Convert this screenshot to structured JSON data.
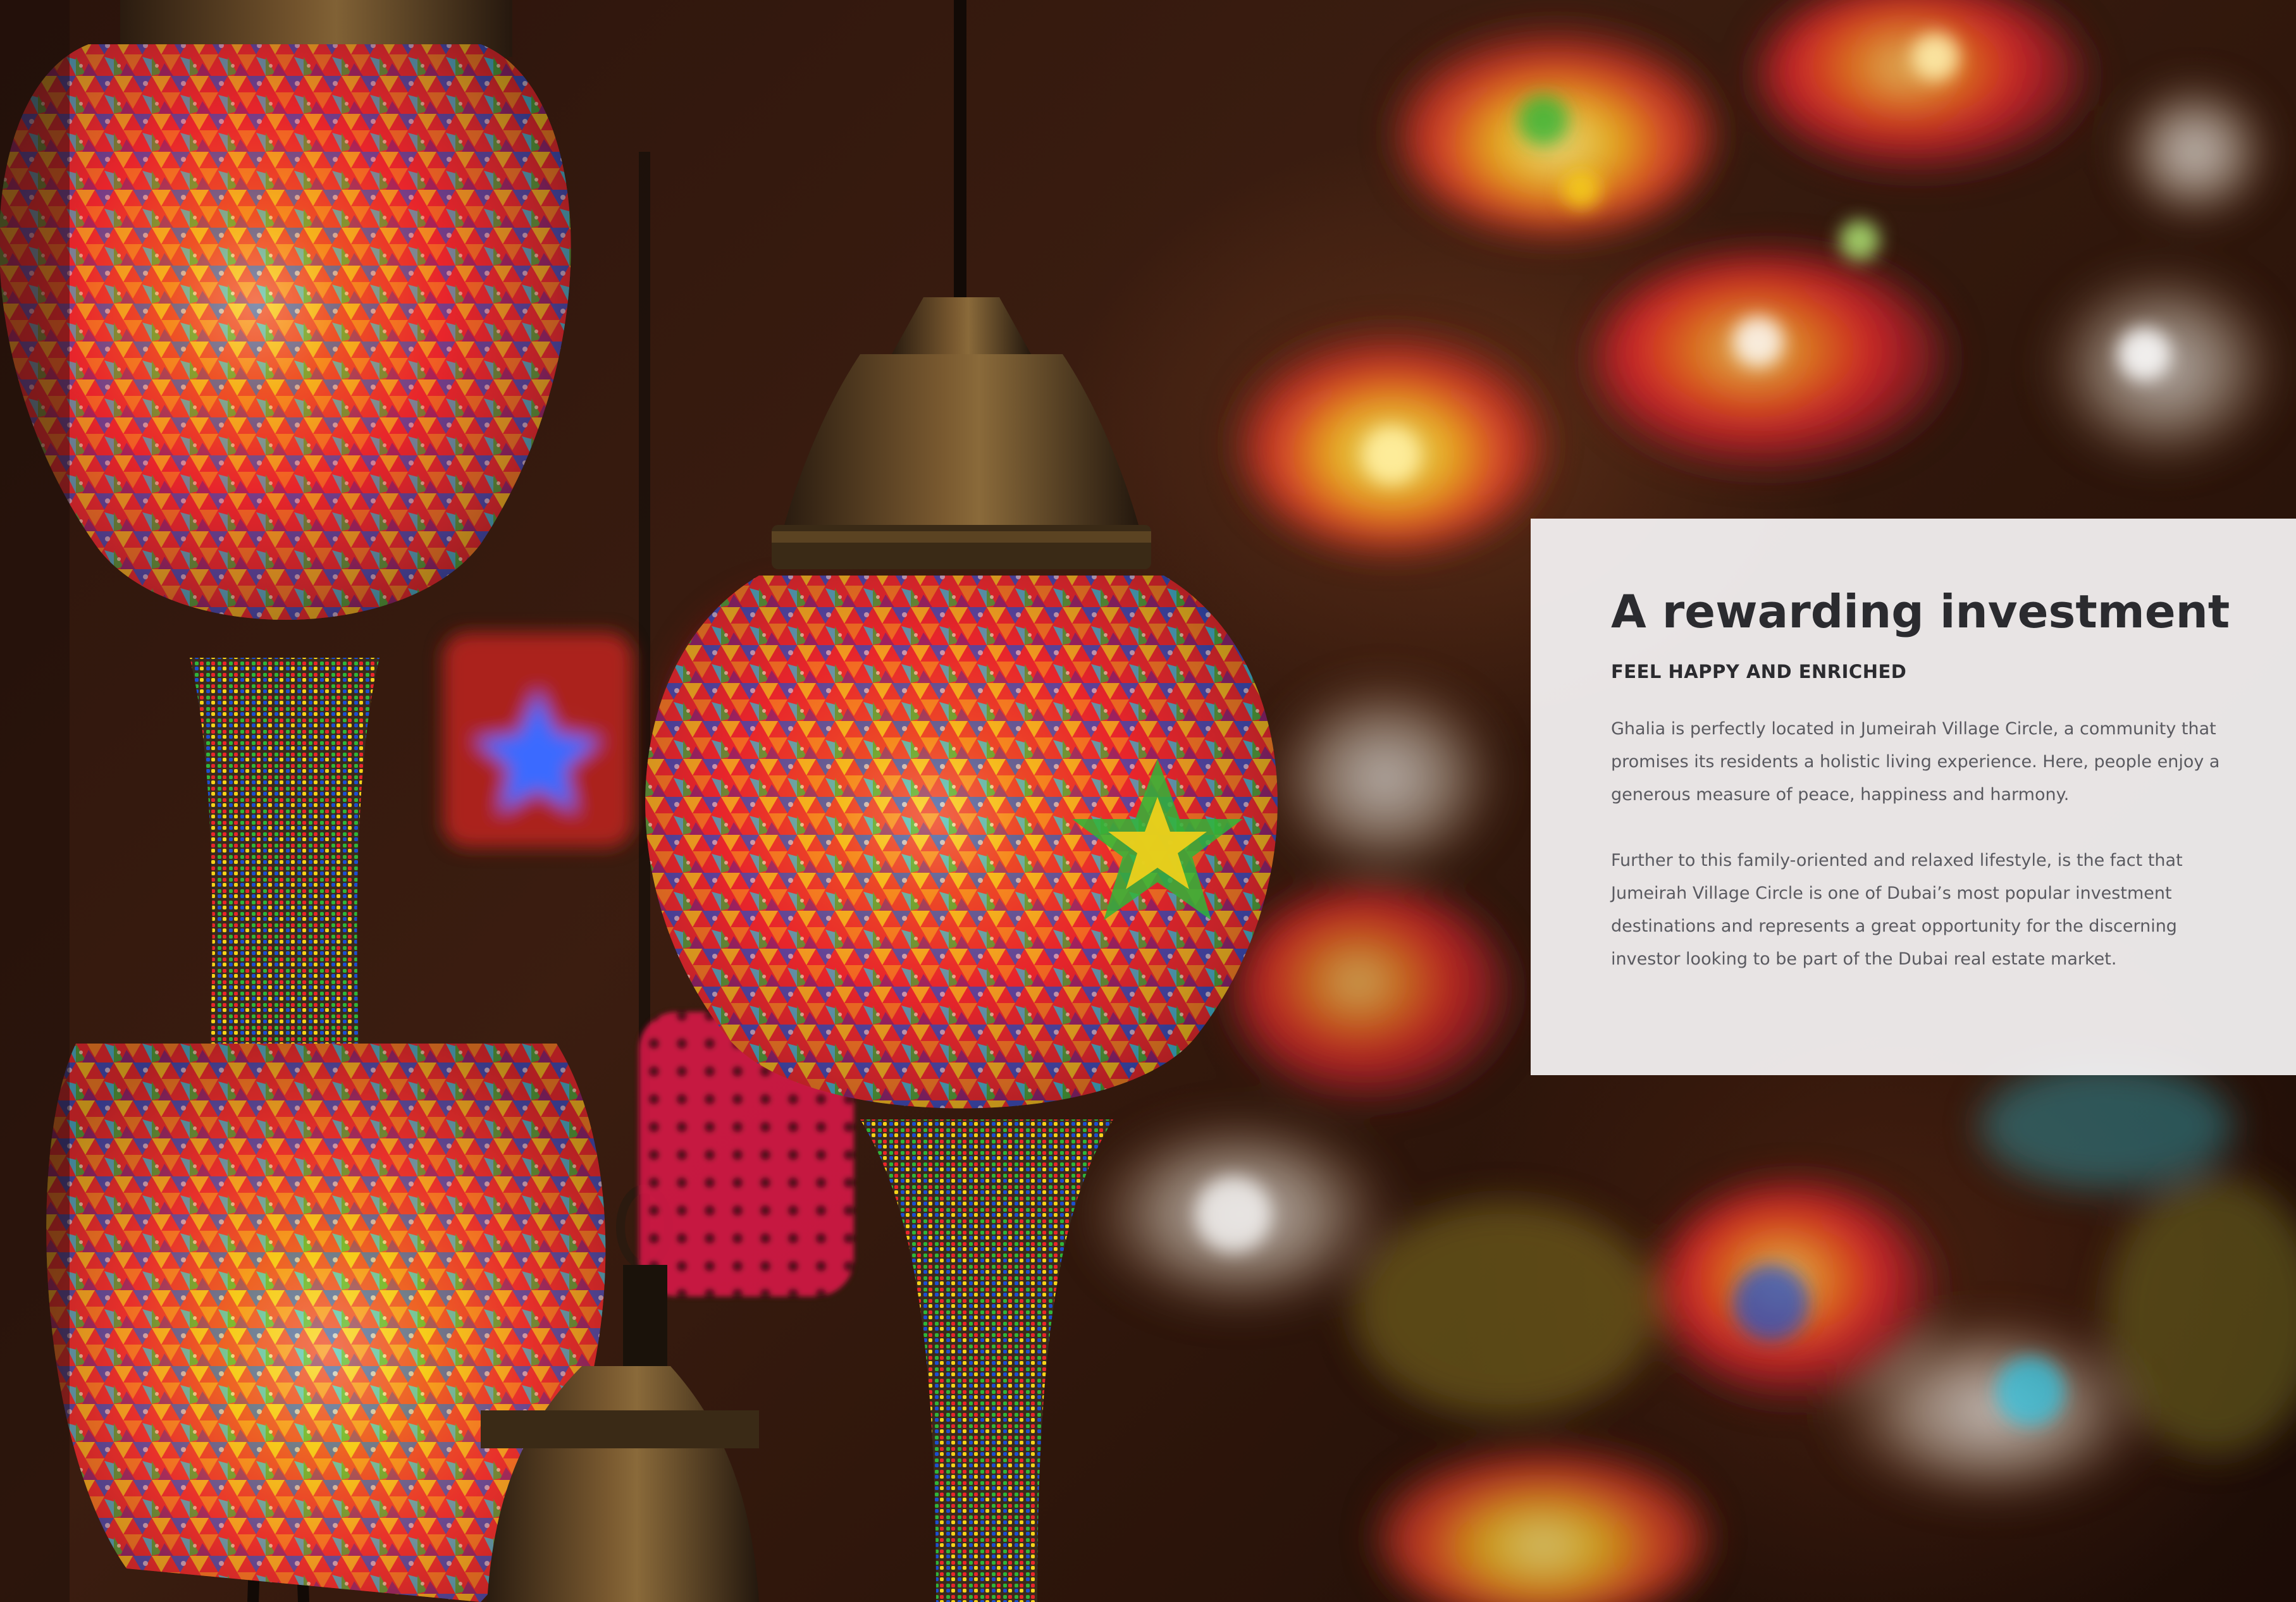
{
  "background_photo": {
    "icon": "mosaic-lanterns-photo",
    "colors": {
      "lantern_red": "#e8252b",
      "lantern_orange": "#f68a1e",
      "lantern_yellow": "#f6d21a",
      "lantern_blue": "#1c4fd0",
      "lantern_cyan": "#26c6e6",
      "lantern_green": "#2fb53a",
      "lantern_purple": "#7a1f78",
      "brass": "#5c4424",
      "warm_dark": "#2a130b"
    }
  },
  "panel": {
    "title": "A rewarding investment",
    "subtitle": "FEEL HAPPY AND ENRICHED",
    "paragraphs": [
      "Ghalia is perfectly located in Jumeirah Village Circle, a community that promises its residents a holistic living experience. Here, people enjoy a generous measure of peace, happiness and harmony.",
      "Further to this family-oriented and relaxed lifestyle, is the fact that Jumeirah Village Circle is one of Dubai’s most popular investment destinations and represents a great opportunity for the discerning investor looking to be part of the Dubai real estate market."
    ],
    "background_color": "#f6f4f5",
    "text_color": "#2b2b2f",
    "body_color": "#5a5a60"
  }
}
